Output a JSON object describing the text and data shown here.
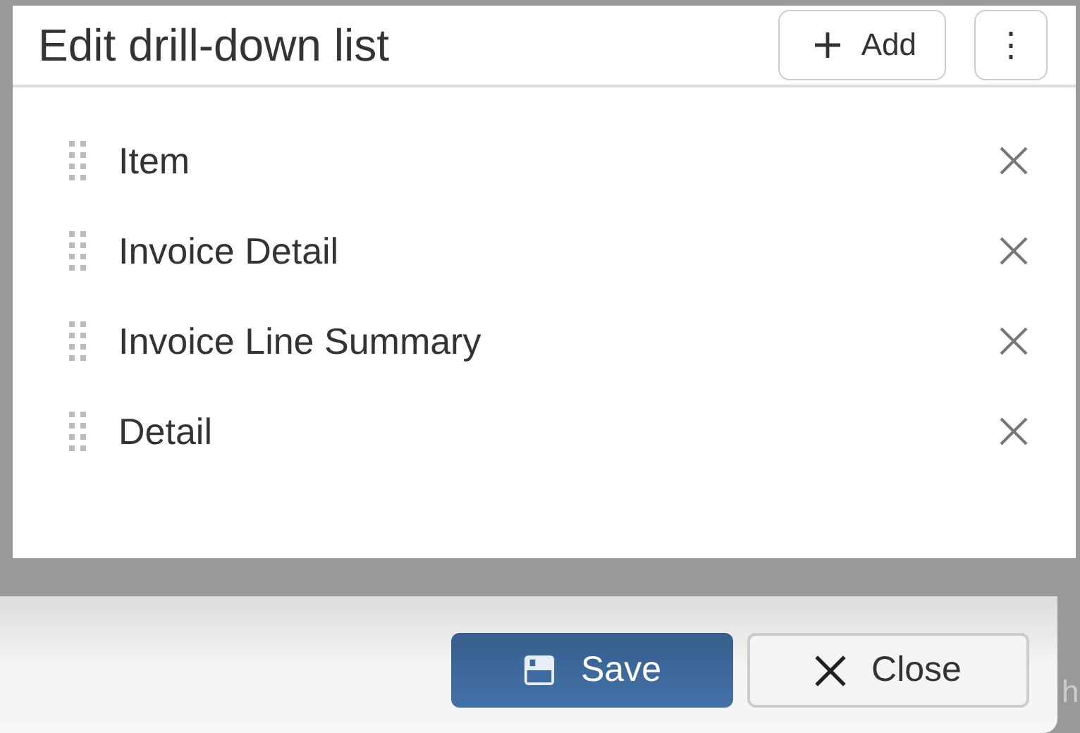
{
  "dialog": {
    "title": "Edit drill-down list",
    "add_button": "Add",
    "menu_button": "⋮"
  },
  "items": [
    {
      "label": "Item"
    },
    {
      "label": "Invoice Detail"
    },
    {
      "label": "Invoice Line Summary"
    },
    {
      "label": "Detail"
    }
  ],
  "footer": {
    "buttons": [
      {
        "kind": "primary",
        "label": "Save"
      },
      {
        "kind": "secondary",
        "label": "Close"
      }
    ],
    "behind_text": "h"
  }
}
